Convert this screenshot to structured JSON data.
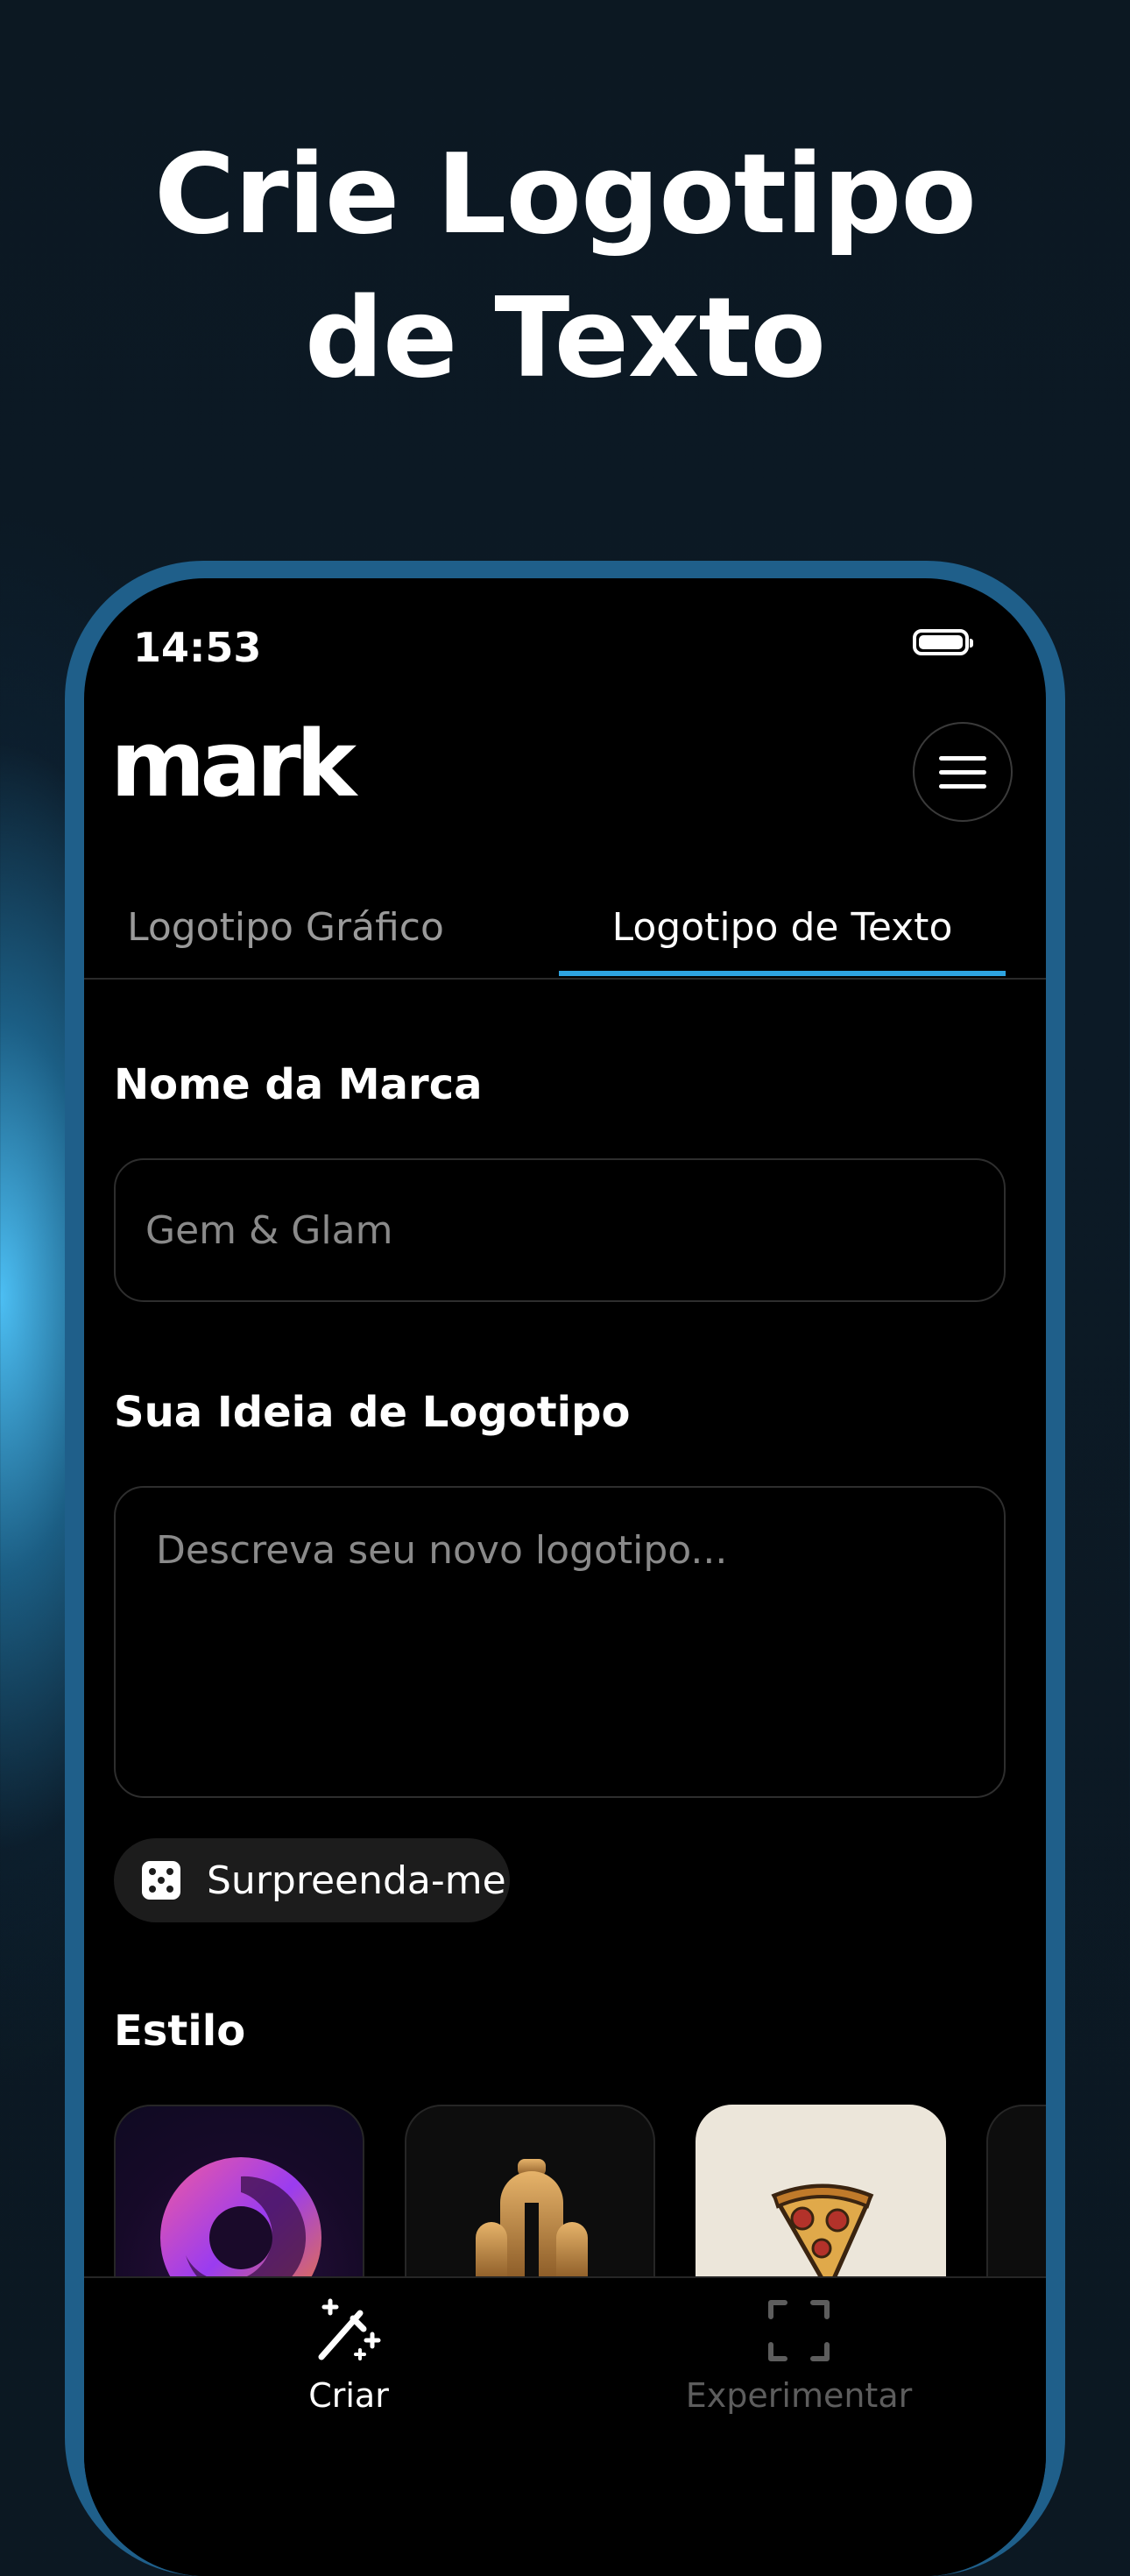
{
  "headline": {
    "line1": "Crie Logotipo",
    "line2": "de Texto"
  },
  "status_bar": {
    "time": "14:53"
  },
  "app": {
    "logo_text": "mark"
  },
  "tabs": [
    {
      "label": "Logotipo Gráfico",
      "active": false
    },
    {
      "label": "Logotipo de Texto",
      "active": true
    }
  ],
  "form": {
    "brand_label": "Nome da Marca",
    "brand_placeholder": "Gem & Glam",
    "idea_label": "Sua Ideia de Logotipo",
    "idea_placeholder": "Descreva seu novo logotipo...",
    "surprise_label": "Surpreenda-me",
    "style_label": "Estilo"
  },
  "styles": [
    {
      "name": "spiral-swirl",
      "colors": [
        "#e040a0",
        "#8a3cf0",
        "#f07a30"
      ]
    },
    {
      "name": "art-deco-arches",
      "colors": [
        "#c8924a"
      ]
    },
    {
      "name": "pizza-slice",
      "colors": [
        "#d4a052",
        "#b3322a"
      ]
    }
  ],
  "bottom_nav": [
    {
      "label": "Criar",
      "icon": "magic-wand-icon",
      "active": true
    },
    {
      "label": "Experimentar",
      "icon": "scan-frame-icon",
      "active": false
    }
  ],
  "colors": {
    "accent": "#2ea3e0",
    "frame": "#1f5f8a"
  }
}
